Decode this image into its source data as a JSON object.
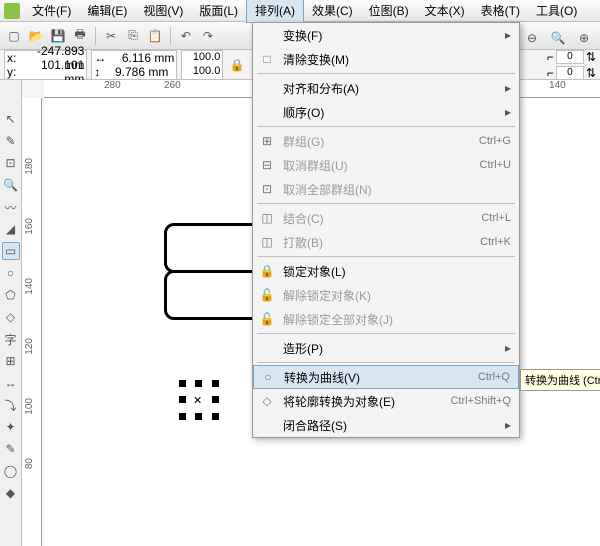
{
  "menus": [
    "文件(F)",
    "编辑(E)",
    "视图(V)",
    "版面(L)",
    "排列(A)",
    "效果(C)",
    "位图(B)",
    "文本(X)",
    "表格(T)",
    "工具(O)"
  ],
  "active_menu_index": 4,
  "coords": {
    "x_label": "x:",
    "x": "-247.893 mm",
    "y_label": "y:",
    "y": "101.101 mm"
  },
  "dims": {
    "w": "6.116 mm",
    "h": "9.786 mm"
  },
  "pct": {
    "w": "100.0",
    "h": "100.0"
  },
  "ruler_h": [
    "280",
    "260",
    "140"
  ],
  "ruler_v": [
    "180",
    "160",
    "140",
    "120",
    "100",
    "80"
  ],
  "right_prop": {
    "v1": "0",
    "v2": "0"
  },
  "dropdown": [
    {
      "type": "item",
      "label": "变换(F)",
      "arrow": true,
      "icon": ""
    },
    {
      "type": "item",
      "label": "清除变换(M)",
      "icon": "□"
    },
    {
      "type": "sep"
    },
    {
      "type": "item",
      "label": "对齐和分布(A)",
      "arrow": true
    },
    {
      "type": "item",
      "label": "顺序(O)",
      "arrow": true
    },
    {
      "type": "sep"
    },
    {
      "type": "item",
      "label": "群组(G)",
      "shortcut": "Ctrl+G",
      "disabled": true,
      "icon": "⊞"
    },
    {
      "type": "item",
      "label": "取消群组(U)",
      "shortcut": "Ctrl+U",
      "disabled": true,
      "icon": "⊟"
    },
    {
      "type": "item",
      "label": "取消全部群组(N)",
      "disabled": true,
      "icon": "⊡"
    },
    {
      "type": "sep"
    },
    {
      "type": "item",
      "label": "结合(C)",
      "shortcut": "Ctrl+L",
      "disabled": true,
      "icon": "◫"
    },
    {
      "type": "item",
      "label": "打散(B)",
      "shortcut": "Ctrl+K",
      "disabled": true,
      "icon": "◫"
    },
    {
      "type": "sep"
    },
    {
      "type": "item",
      "label": "锁定对象(L)",
      "icon": "🔒"
    },
    {
      "type": "item",
      "label": "解除锁定对象(K)",
      "disabled": true,
      "icon": "🔓"
    },
    {
      "type": "item",
      "label": "解除锁定全部对象(J)",
      "disabled": true,
      "icon": "🔓"
    },
    {
      "type": "sep"
    },
    {
      "type": "item",
      "label": "造形(P)",
      "arrow": true
    },
    {
      "type": "sep"
    },
    {
      "type": "item",
      "label": "转换为曲线(V)",
      "shortcut": "Ctrl+Q",
      "hover": true,
      "icon": "○"
    },
    {
      "type": "item",
      "label": "将轮廓转换为对象(E)",
      "shortcut": "Ctrl+Shift+Q",
      "icon": "◇"
    },
    {
      "type": "item",
      "label": "闭合路径(S)",
      "arrow": true
    }
  ],
  "tooltip": "转换为曲线 (Ctr"
}
